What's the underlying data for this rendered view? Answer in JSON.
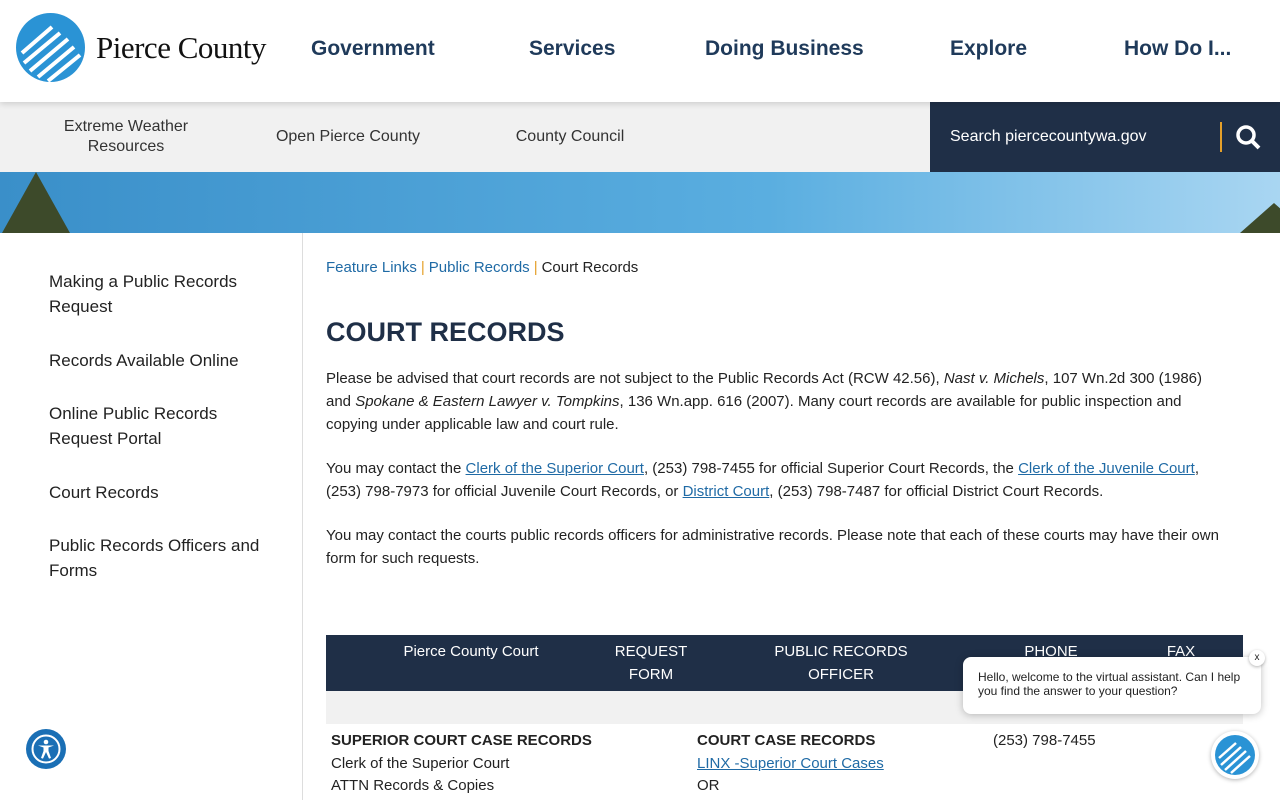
{
  "header": {
    "logo_text": "Pierce County",
    "nav": [
      "Government",
      "Services",
      "Doing Business",
      "Explore",
      "How Do I..."
    ]
  },
  "subnav": {
    "links": [
      "Extreme Weather Resources",
      "Open Pierce County",
      "County Council"
    ],
    "search_placeholder": "Search piercecountywa.gov"
  },
  "sidebar": {
    "items": [
      "Making a Public Records Request",
      "Records Available Online",
      "Online Public Records Request Portal",
      "Court Records",
      "Public Records Officers and Forms"
    ]
  },
  "breadcrumb": [
    "Feature Links",
    "Public Records",
    "Court Records"
  ],
  "page_title": "COURT RECORDS",
  "para1": {
    "a": "Please be advised that court records are not subject to the Public Records Act (RCW 42.56), ",
    "b": "Nast v. Michels",
    "c": ", 107 Wn.2d 300 (1986) and ",
    "d": "Spokane & Eastern Lawyer v. Tompkins",
    "e": ", 136 Wn.app. 616 (2007). Many court records are available for public inspection and copying under applicable law and court rule."
  },
  "para2": {
    "a": "You may contact the ",
    "l1": "Clerk of the Superior Court",
    "b": ", (253) 798-7455 for official Superior Court Records, the ",
    "l2": "Clerk of the Juvenile Court",
    "c": ", (253) 798-7973 for official Juvenile Court Records, or ",
    "l3": "District Court",
    "d": ", (253) 798-7487 for official District Court Records."
  },
  "para3": "You may contact the courts public records officers for administrative records. Please note that each of these courts may have their own form for such requests.",
  "table": {
    "headers": [
      "Pierce County Court",
      "REQUEST FORM",
      "PUBLIC RECORDS OFFICER",
      "PHONE",
      "FAX"
    ],
    "row1": {
      "court": [
        "SUPERIOR COURT CASE RECORDS",
        "Clerk of the Superior Court",
        "ATTN Records & Copies"
      ],
      "officer_title": "COURT CASE RECORDS",
      "officer_link": "LINX -Superior Court Cases",
      "officer_or": "OR",
      "phone": "(253) 798-7455"
    }
  },
  "chat": {
    "message": "Hello, welcome to the virtual assistant. Can I help you find the answer to your question?",
    "close": "x"
  },
  "colors": {
    "navy": "#1f2f47",
    "link": "#1f6aa5",
    "accent": "#e5a02a",
    "logo_blue": "#2a93d5"
  }
}
